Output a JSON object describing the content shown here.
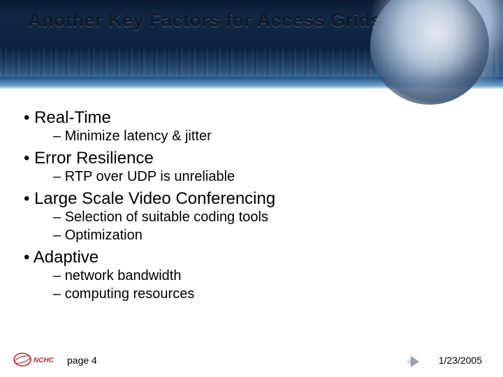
{
  "title": "Another Key Factors for Access Grids",
  "bullets": {
    "b0": {
      "text": "Real-Time",
      "subs": {
        "s0": "Minimize latency & jitter"
      }
    },
    "b1": {
      "text": "Error Resilience",
      "subs": {
        "s0": "RTP over UDP is unreliable"
      }
    },
    "b2": {
      "text": "Large Scale Video Conferencing",
      "subs": {
        "s0": "Selection of suitable coding tools",
        "s1": "Optimization"
      }
    },
    "b3": {
      "text": "Adaptive",
      "subs": {
        "s0": "network bandwidth",
        "s1": "computing resources"
      }
    }
  },
  "footer": {
    "page": "page 4",
    "date": "1/23/2005",
    "logo_text": "NCHC"
  }
}
